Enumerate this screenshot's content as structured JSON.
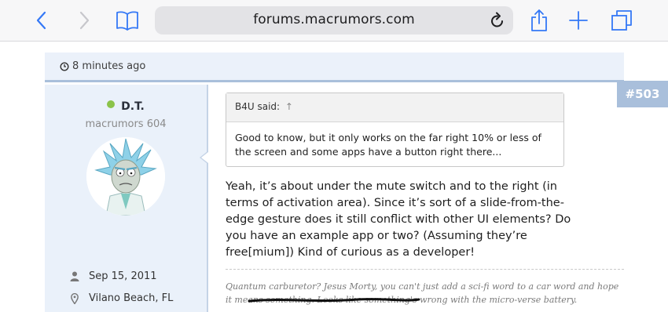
{
  "browser": {
    "url": "forums.macrumors.com",
    "icons": [
      "back-icon",
      "forward-icon",
      "bookmarks-icon",
      "reload-icon",
      "share-icon",
      "new-tab-icon",
      "tabs-icon"
    ]
  },
  "post": {
    "time": "8 minutes ago",
    "number": "#503",
    "author": {
      "name": "D.T.",
      "title": "macrumors 604",
      "joined": "Sep 15, 2011",
      "location": "Vilano Beach, FL",
      "online_color": "#8bc34a"
    },
    "quote": {
      "author_label": "B4U said:",
      "arrow": "↑",
      "text": "Good to know, but it only works on the far right 10% or less of the screen and some apps have a button right there..."
    },
    "message": "Yeah, it’s about under the mute switch and to the right (in terms of activation area). Since it’s sort of a slide-from-the-edge gesture does it still conflict with other UI elements? Do you have an example app or two? (Assuming they’re free[mium]) Kind of curious as a developer!",
    "signature": "Quantum carburetor? Jesus Morty, you can't just add a sci-fi word to a car word and hope it means something. Looks like something's wrong with the micro-verse battery."
  },
  "colors": {
    "accent": "#3478f6",
    "header_bg": "#ebf1fa",
    "post_number_bg": "#a9bfdb"
  }
}
